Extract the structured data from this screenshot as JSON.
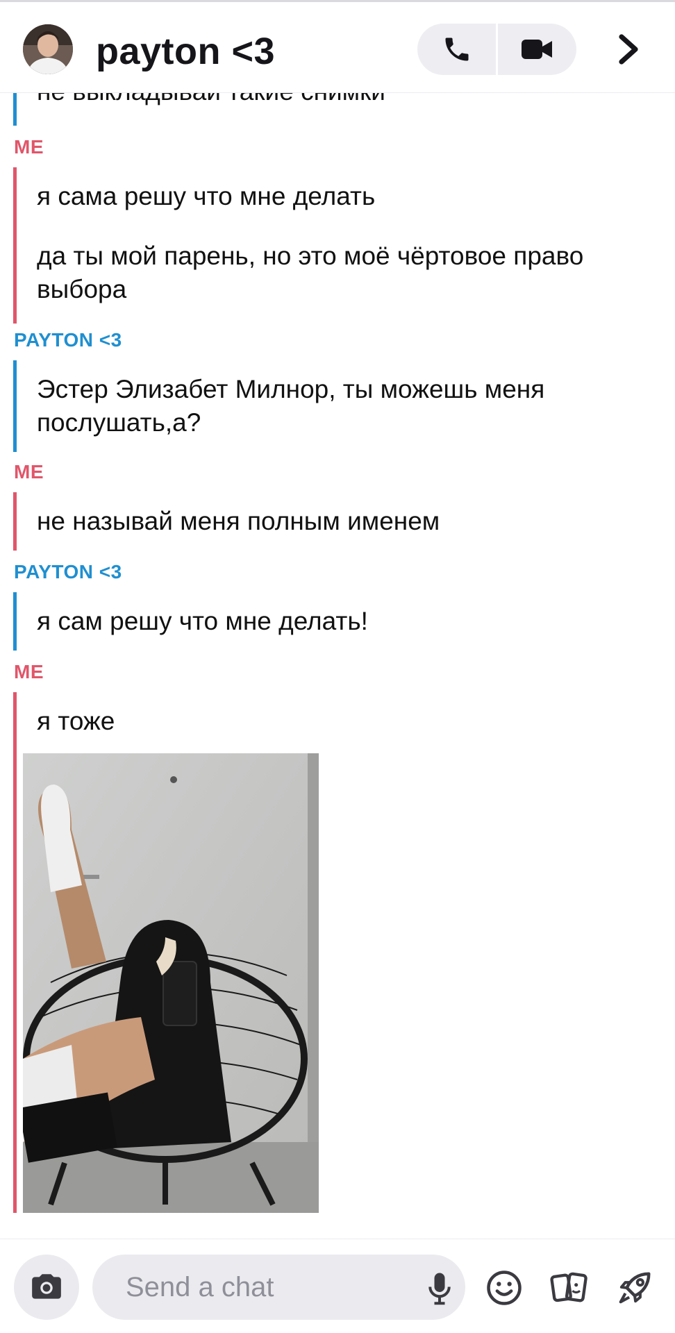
{
  "header": {
    "title": "payton <3"
  },
  "messages": [
    {
      "sender_label": "",
      "text": "не выкладывай такие снимки"
    },
    {
      "sender_label": "ME",
      "text": "я сама решу что мне делать"
    },
    {
      "sender_label": "",
      "text": "да ты мой парень, но это моё чёртовое право выбора"
    },
    {
      "sender_label": "PAYTON <3",
      "text": "Эстер Элизабет Милнор, ты можешь меня послушать,а?"
    },
    {
      "sender_label": "ME",
      "text": "не называй меня полным именем"
    },
    {
      "sender_label": "PAYTON <3",
      "text": "я сам решу что мне делать!"
    },
    {
      "sender_label": "ME",
      "text": "я тоже"
    }
  ],
  "composer": {
    "placeholder": "Send a chat"
  },
  "colors": {
    "me": "#e0566a",
    "payton": "#1f8fd0"
  },
  "icons": [
    "phone-icon",
    "video-icon",
    "chevron-right-icon",
    "camera-icon",
    "microphone-icon",
    "smiley-icon",
    "cards-icon",
    "rocket-icon"
  ]
}
